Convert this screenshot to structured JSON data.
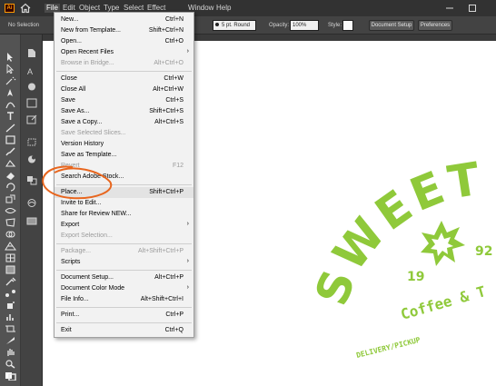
{
  "app": {
    "logo_text": "Ai"
  },
  "menubar": {
    "items": [
      "File",
      "Edit",
      "Object",
      "Type",
      "Select",
      "Effect",
      "Window",
      "Help"
    ],
    "active": "File"
  },
  "controlbar": {
    "selection_label": "No Selection",
    "stroke_profile": "5 pt. Round",
    "opacity_label": "Opacity:",
    "opacity_value": "100%",
    "style_label": "Style:",
    "document_setup_label": "Document Setup",
    "preferences_label": "Preferences"
  },
  "file_menu": {
    "items": [
      {
        "label": "New...",
        "shortcut": "Ctrl+N",
        "disabled": false
      },
      {
        "label": "New from Template...",
        "shortcut": "Shift+Ctrl+N",
        "disabled": false
      },
      {
        "label": "Open...",
        "shortcut": "Ctrl+O",
        "disabled": false
      },
      {
        "label": "Open Recent Files",
        "shortcut": "",
        "submenu": true,
        "disabled": false
      },
      {
        "label": "Browse in Bridge...",
        "shortcut": "Alt+Ctrl+O",
        "disabled": true
      },
      {
        "label": "Close",
        "shortcut": "Ctrl+W",
        "disabled": false
      },
      {
        "label": "Close All",
        "shortcut": "Alt+Ctrl+W",
        "disabled": false
      },
      {
        "label": "Save",
        "shortcut": "Ctrl+S",
        "disabled": false
      },
      {
        "label": "Save As...",
        "shortcut": "Shift+Ctrl+S",
        "disabled": false
      },
      {
        "label": "Save a Copy...",
        "shortcut": "Alt+Ctrl+S",
        "disabled": false
      },
      {
        "label": "Save Selected Slices...",
        "shortcut": "",
        "disabled": true
      },
      {
        "label": "Version History",
        "shortcut": "",
        "disabled": false
      },
      {
        "label": "Save as Template...",
        "shortcut": "",
        "disabled": false
      },
      {
        "label": "Revert",
        "shortcut": "F12",
        "disabled": true
      },
      {
        "label": "Search Adobe Stock...",
        "shortcut": "",
        "disabled": false
      },
      {
        "label": "Place...",
        "shortcut": "Shift+Ctrl+P",
        "disabled": false,
        "highlight": true
      },
      {
        "label": "Invite to Edit...",
        "shortcut": "",
        "disabled": false
      },
      {
        "label": "Share for Review NEW...",
        "shortcut": "",
        "disabled": false
      },
      {
        "label": "Export",
        "shortcut": "",
        "submenu": true,
        "disabled": false
      },
      {
        "label": "Export Selection...",
        "shortcut": "",
        "disabled": true
      },
      {
        "label": "Package...",
        "shortcut": "Alt+Shift+Ctrl+P",
        "disabled": true
      },
      {
        "label": "Scripts",
        "shortcut": "",
        "submenu": true,
        "disabled": false
      },
      {
        "label": "Document Setup...",
        "shortcut": "Alt+Ctrl+P",
        "disabled": false
      },
      {
        "label": "Document Color Mode",
        "shortcut": "",
        "submenu": true,
        "disabled": false
      },
      {
        "label": "File Info...",
        "shortcut": "Alt+Shift+Ctrl+I",
        "disabled": false
      },
      {
        "label": "Print...",
        "shortcut": "Ctrl+P",
        "disabled": false
      },
      {
        "label": "Exit",
        "shortcut": "Ctrl+Q",
        "disabled": false
      }
    ]
  },
  "artwork": {
    "headline": "SWEET R",
    "year_left": "19",
    "year_right": "92",
    "tagline": "Coffee & T",
    "subtag": "DELIVERY/PICKUP",
    "color": "#8fc93a"
  },
  "annotation_color": "#e8661e",
  "colors": {
    "menubar_bg": "#323232",
    "panel_bg": "#535353",
    "menu_bg": "#f2f2f2"
  },
  "icons": {
    "home": "home-icon",
    "minimize": "minimize-icon",
    "maximize": "maximize-icon",
    "submenu": "chevron-right-icon"
  }
}
